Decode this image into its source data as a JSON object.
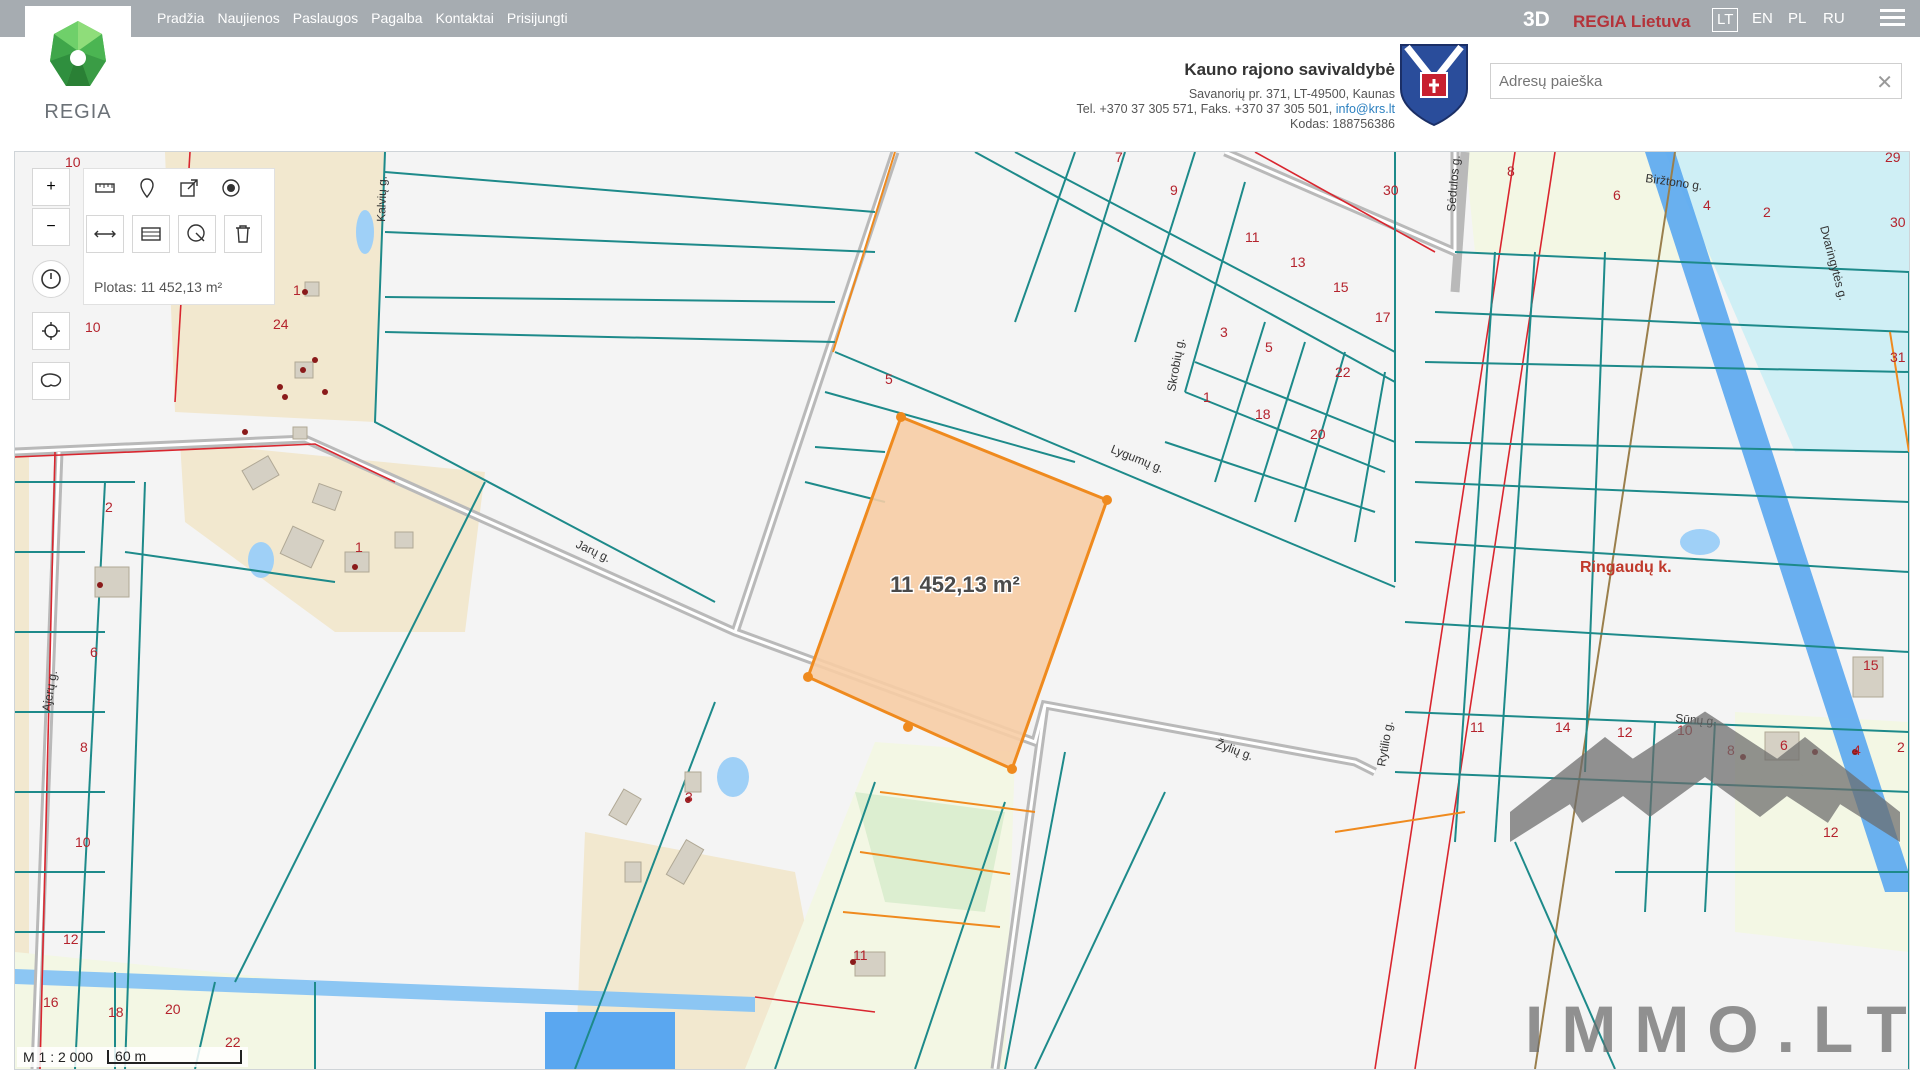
{
  "header": {
    "logo_text": "REGIA",
    "nav": [
      "Pradžia",
      "Naujienos",
      "Paslaugos",
      "Pagalba",
      "Kontaktai",
      "Prisijungti"
    ],
    "btn_3d": "3D",
    "regia_lietuva": "REGIA Lietuva",
    "languages": [
      {
        "code": "LT",
        "active": true
      },
      {
        "code": "EN",
        "active": false
      },
      {
        "code": "PL",
        "active": false
      },
      {
        "code": "RU",
        "active": false
      }
    ],
    "municipality": {
      "name": "Kauno rajono savivaldybė",
      "address": "Savanorių pr. 371, LT-49500, Kaunas",
      "phone": "Tel. +370 37 305 571, Faks. +370 37 305 501,",
      "email": "info@krs.lt",
      "code": "Kodas: 188756386"
    },
    "search": {
      "placeholder": "Adresų paieška",
      "clear": "✕"
    }
  },
  "map": {
    "tools": {
      "zoom_in": "+",
      "zoom_out": "−",
      "area_label": "Plotas: 11 452,13 m²"
    },
    "selected_area": "11 452,13 m²",
    "village": "Ringaudų k.",
    "streets": [
      "Kalvių g.",
      "Jarų g.",
      "Lygumų g.",
      "Skrobių g.",
      "Sėdulos g.",
      "Biržtono g.",
      "Dvaringytės g.",
      "Ajerų g.",
      "Žylių g.",
      "Rytilio g.",
      "Sūnų g."
    ],
    "parcel_numbers": [
      "10",
      "10",
      "1",
      "24",
      "2",
      "1",
      "6",
      "8",
      "10",
      "12",
      "16",
      "18",
      "20",
      "22",
      "3",
      "11",
      "5",
      "7",
      "9",
      "30",
      "11",
      "13",
      "15",
      "17",
      "3",
      "5",
      "22",
      "1",
      "18",
      "20",
      "8",
      "6",
      "4",
      "2",
      "29",
      "30",
      "31",
      "11",
      "14",
      "12",
      "10",
      "8",
      "6",
      "4",
      "2",
      "12",
      "15"
    ],
    "scale": {
      "ratio": "M 1 : 2 000",
      "bar": "60 m"
    },
    "watermark": "IMMO.LT"
  },
  "colors": {
    "topbar": "#a6acb1",
    "parcel_line": "#1d8a8a",
    "selection_fill": "#f7cda5",
    "selection_stroke": "#ef8a1e",
    "river": "#5aa7f0",
    "settlement": "#f2e8cf",
    "red_text": "#b4232d"
  }
}
